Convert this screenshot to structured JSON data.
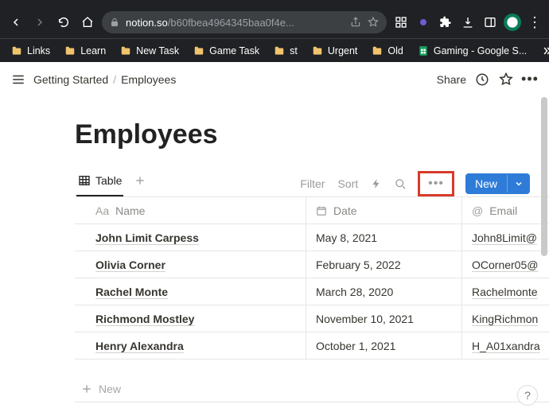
{
  "browser": {
    "url_host": "notion.so",
    "url_path": "/b60fbea4964345baa0f4e...",
    "bookmarks": [
      {
        "label": "Links",
        "kind": "folder"
      },
      {
        "label": "Learn",
        "kind": "folder"
      },
      {
        "label": "New Task",
        "kind": "folder"
      },
      {
        "label": "Game Task",
        "kind": "folder"
      },
      {
        "label": "st",
        "kind": "folder"
      },
      {
        "label": "Urgent",
        "kind": "folder"
      },
      {
        "label": "Old",
        "kind": "folder"
      },
      {
        "label": "Gaming - Google S...",
        "kind": "sheets"
      }
    ]
  },
  "topbar": {
    "crumb1": "Getting Started",
    "crumb2": "Employees",
    "share": "Share"
  },
  "page": {
    "title": "Employees"
  },
  "view": {
    "tab_label": "Table",
    "filter": "Filter",
    "sort": "Sort",
    "more": "•••",
    "new": "New"
  },
  "columns": {
    "name": "Name",
    "date": "Date",
    "email": "Email"
  },
  "rows": [
    {
      "name": "John Limit Carpess",
      "date": "May 8, 2021",
      "email": "John8Limit@"
    },
    {
      "name": "Olivia Corner",
      "date": "February 5, 2022",
      "email": "OCorner05@"
    },
    {
      "name": "Rachel Monte",
      "date": "March 28, 2020",
      "email": "Rachelmonte"
    },
    {
      "name": "Richmond Mostley",
      "date": "November 10, 2021",
      "email": "KingRichmon"
    },
    {
      "name": "Henry Alexandra",
      "date": "October 1, 2021",
      "email": "H_A01xandra"
    }
  ],
  "newrow": "New",
  "help": "?"
}
